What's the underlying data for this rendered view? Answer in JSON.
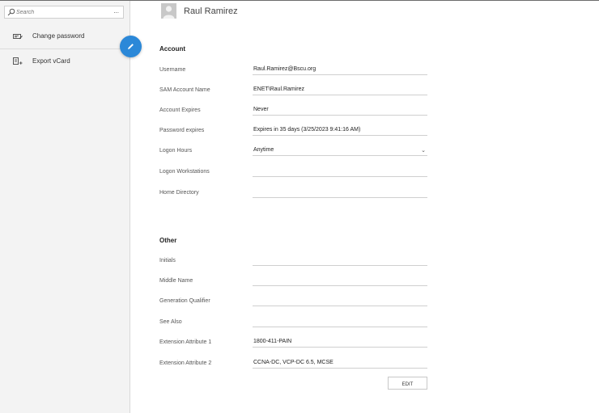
{
  "search": {
    "placeholder": "Search",
    "more_label": "..."
  },
  "sidebar": {
    "items": [
      {
        "label": "Change password",
        "icon": "keyboard-pen-icon"
      },
      {
        "label": "Export vCard",
        "icon": "export-card-icon"
      }
    ]
  },
  "header": {
    "name": "Raul Ramirez",
    "avatar_icon": "user-avatar-icon"
  },
  "account": {
    "title": "Account",
    "rows": [
      {
        "label": "Username",
        "value": "Raul.Ramirez@Bscu.org"
      },
      {
        "label": "SAM Account Name",
        "value": "ENET\\Raul.Ramirez"
      },
      {
        "label": "Account Expires",
        "value": "Never"
      },
      {
        "label": "Password expires",
        "value": "Expires in 35 days (3/25/2023 9:41:16 AM)"
      },
      {
        "label": "Logon Hours",
        "value": "Anytime"
      },
      {
        "label": "Logon Workstations",
        "value": ""
      },
      {
        "label": "Home Directory",
        "value": ""
      }
    ]
  },
  "other": {
    "title": "Other",
    "rows": [
      {
        "label": "Initials",
        "value": ""
      },
      {
        "label": "Middle Name",
        "value": ""
      },
      {
        "label": "Generation Qualifier",
        "value": ""
      },
      {
        "label": "See Also",
        "value": ""
      },
      {
        "label": "Extension Attribute 1",
        "value": "1800-411-PAIN"
      },
      {
        "label": "Extension Attribute 2",
        "value": "CCNA-DC, VCP-DC 6.5, MCSE"
      }
    ]
  },
  "edit_label": "EDIT",
  "colors": {
    "accent": "#2b88d8",
    "sidebar_bg": "#f3f3f3"
  }
}
